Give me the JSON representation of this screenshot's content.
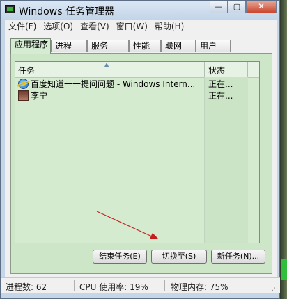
{
  "window": {
    "title": "Windows 任务管理器",
    "caption_buttons": {
      "minimize": "—",
      "maximize": "▢",
      "close": "✕"
    }
  },
  "menu": [
    "文件(F)",
    "选项(O)",
    "查看(V)",
    "窗口(W)",
    "帮助(H)"
  ],
  "tabs": [
    {
      "label": "应用程序",
      "active": true
    },
    {
      "label": "进程",
      "active": false
    },
    {
      "label": "服务",
      "active": false
    },
    {
      "label": "性能",
      "active": false
    },
    {
      "label": "联网",
      "active": false
    },
    {
      "label": "用户",
      "active": false
    }
  ],
  "task_list": {
    "columns": {
      "task": "任务",
      "status": "状态"
    },
    "sort_indicator": "▲",
    "rows": [
      {
        "name": "百度知道一一提问问题 - Windows Intern...",
        "status": "正在...",
        "icon": "ie-icon"
      },
      {
        "name": "李宁",
        "status": "正在...",
        "icon": "user-avatar-icon"
      }
    ]
  },
  "annotation": {
    "color": "#c81e1e"
  },
  "buttons": {
    "end_task": "结束任务(E)",
    "switch_to": "切换至(S)",
    "new_task": "新任务(N)..."
  },
  "statusbar": {
    "processes": "进程数: 62",
    "cpu": "CPU 使用率: 19%",
    "memory": "物理内存: 75%"
  },
  "colors": {
    "panel_bg": "#cde6c8",
    "titlebar": "#c4d6e8",
    "close_button": "#c9462c"
  }
}
